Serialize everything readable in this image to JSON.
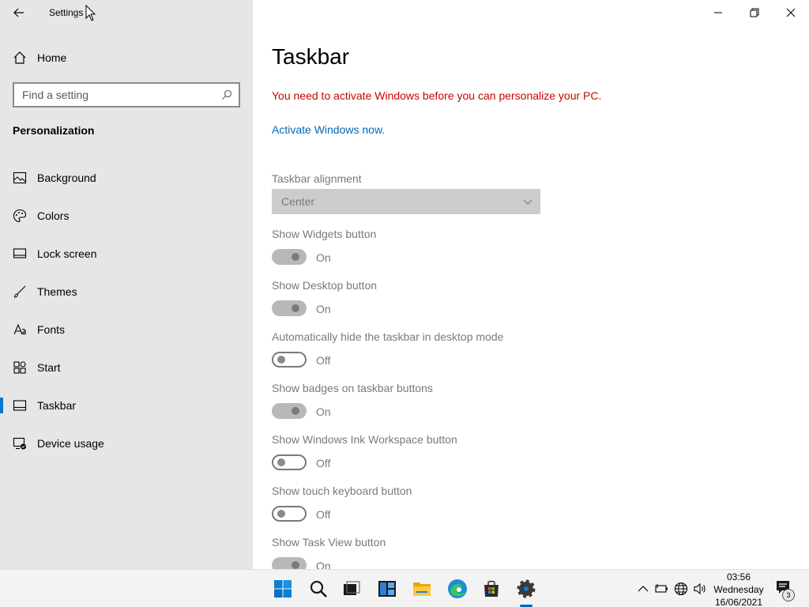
{
  "window": {
    "app_title": "Settings"
  },
  "sidebar": {
    "home_label": "Home",
    "search_placeholder": "Find a setting",
    "section_title": "Personalization",
    "items": [
      {
        "label": "Background",
        "icon": "picture-icon"
      },
      {
        "label": "Colors",
        "icon": "palette-icon"
      },
      {
        "label": "Lock screen",
        "icon": "lock-screen-icon"
      },
      {
        "label": "Themes",
        "icon": "brush-icon"
      },
      {
        "label": "Fonts",
        "icon": "font-icon"
      },
      {
        "label": "Start",
        "icon": "start-grid-icon"
      },
      {
        "label": "Taskbar",
        "icon": "taskbar-icon",
        "selected": true
      },
      {
        "label": "Device usage",
        "icon": "device-usage-icon"
      }
    ]
  },
  "main": {
    "title": "Taskbar",
    "activation_warning": "You need to activate Windows before you can personalize your PC.",
    "activation_link": "Activate Windows now.",
    "alignment": {
      "label": "Taskbar alignment",
      "value": "Center"
    },
    "settings": [
      {
        "label": "Show Widgets button",
        "state": "On"
      },
      {
        "label": "Show Desktop button",
        "state": "On"
      },
      {
        "label": "Automatically hide the taskbar in desktop mode",
        "state": "Off"
      },
      {
        "label": "Show badges on taskbar buttons",
        "state": "On"
      },
      {
        "label": "Show Windows Ink Workspace button",
        "state": "Off"
      },
      {
        "label": "Show touch keyboard button",
        "state": "Off"
      },
      {
        "label": "Show Task View button",
        "state": "On"
      }
    ]
  },
  "taskbar": {
    "apps": [
      "start-icon",
      "search-icon",
      "task-view-icon",
      "widgets-icon",
      "file-explorer-icon",
      "edge-icon",
      "store-icon",
      "settings-gear-icon"
    ],
    "clock": {
      "time": "03:56",
      "day": "Wednesday",
      "date": "16/06/2021"
    },
    "notification_count": "3"
  },
  "colors": {
    "accent": "#0078d4",
    "warning": "#c50500",
    "link": "#0067b8",
    "sidebar_bg": "#e6e6e6"
  }
}
